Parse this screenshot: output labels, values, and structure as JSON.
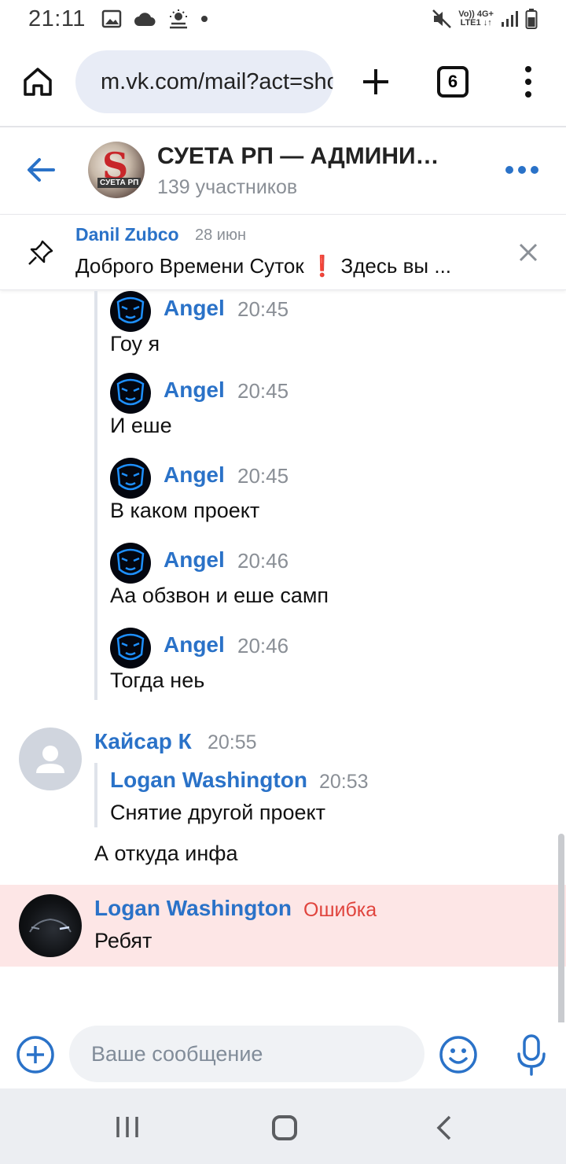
{
  "status_bar": {
    "time": "21:11",
    "network_top": "Vo)) 4G+",
    "network_bottom": "LTE1 ↓↑",
    "icons": [
      "image-icon",
      "cloud-icon",
      "sun-cloud-icon",
      "dot-icon",
      "mute-icon",
      "signal-icon",
      "battery-icon"
    ]
  },
  "browser": {
    "url": "m.vk.com/mail?act=show",
    "tab_count": "6",
    "icons": [
      "home-icon",
      "site-settings-icon",
      "plus-icon",
      "tabs-icon",
      "menu-icon"
    ]
  },
  "chat": {
    "title": "СУЕТА РП — АДМИНИ…",
    "subtitle": "139 участников",
    "avatar_letter": "S",
    "avatar_brand": "СУЕТА РП"
  },
  "pinned": {
    "author": "Danil Zubco",
    "date": "28 июн",
    "text": "Доброго Времени Суток ❗ Здесь вы ..."
  },
  "forwarded": [
    {
      "name": "Angel",
      "time": "20:45",
      "text": "Гоу я"
    },
    {
      "name": "Angel",
      "time": "20:45",
      "text": "И еше"
    },
    {
      "name": "Angel",
      "time": "20:45",
      "text": "В каком проект"
    },
    {
      "name": "Angel",
      "time": "20:46",
      "text": "Аа обзвон и еше самп"
    },
    {
      "name": "Angel",
      "time": "20:46",
      "text": "Тогда неь"
    }
  ],
  "message_kaisar": {
    "name": "Кайсар К",
    "time": "20:55",
    "quote_name": "Logan Washington",
    "quote_time": "20:53",
    "quote_text": "Снятие другой проект",
    "text": "А откуда инфа"
  },
  "message_logan": {
    "name": "Logan Washington",
    "error": "Ошибка",
    "text": "Ребят"
  },
  "composer": {
    "placeholder": "Ваше сообщение"
  },
  "colors": {
    "accent": "#2a72c8",
    "error": "#e0443d",
    "error_bg": "#fde6e6"
  }
}
